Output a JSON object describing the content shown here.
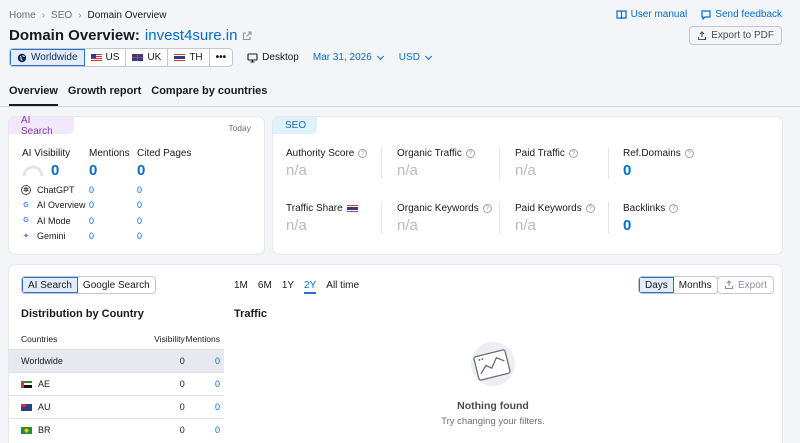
{
  "breadcrumb": [
    "Home",
    "SEO",
    "Domain Overview"
  ],
  "header": {
    "title": "Domain Overview:",
    "domain": "invest4sure.in",
    "user_manual": "User manual",
    "send_feedback": "Send feedback",
    "export_pdf": "Export to PDF"
  },
  "filters": {
    "regions": [
      {
        "label": "Worldwide",
        "icon": "globe-icon",
        "active": true
      },
      {
        "label": "US",
        "icon": "us-flag-icon"
      },
      {
        "label": "UK",
        "icon": "uk-flag-icon"
      },
      {
        "label": "TH",
        "icon": "th-flag-icon"
      },
      {
        "label": "•••",
        "icon": "more-icon"
      }
    ],
    "device": "Desktop",
    "date": "Mar 31, 2026",
    "currency": "USD"
  },
  "tabs": [
    "Overview",
    "Growth report",
    "Compare by countries"
  ],
  "ai_card": {
    "tag": "AI Search",
    "period": "Today",
    "visibility_label": "AI Visibility",
    "visibility_value": "0",
    "mentions_label": "Mentions",
    "mentions_value": "0",
    "cited_label": "Cited Pages",
    "cited_value": "0",
    "rows": [
      {
        "name": "ChatGPT",
        "mentions": "0",
        "cited": "0"
      },
      {
        "name": "AI Overview",
        "mentions": "0",
        "cited": "0"
      },
      {
        "name": "AI Mode",
        "mentions": "0",
        "cited": "0"
      },
      {
        "name": "Gemini",
        "mentions": "0",
        "cited": "0"
      }
    ]
  },
  "seo_card": {
    "tag": "SEO",
    "metrics": [
      {
        "label": "Authority Score",
        "value": "n/a"
      },
      {
        "label": "Organic Traffic",
        "value": "n/a"
      },
      {
        "label": "Paid Traffic",
        "value": "n/a"
      },
      {
        "label": "Ref.Domains",
        "value": "0"
      },
      {
        "label": "Traffic Share",
        "value": "n/a"
      },
      {
        "label": "Organic Keywords",
        "value": "n/a"
      },
      {
        "label": "Paid Keywords",
        "value": "n/a"
      },
      {
        "label": "Backlinks",
        "value": "0"
      }
    ]
  },
  "bottom": {
    "search_toggle": [
      "AI Search",
      "Google Search"
    ],
    "ranges": [
      "1M",
      "6M",
      "1Y",
      "2Y",
      "All time"
    ],
    "active_range": "2Y",
    "granularity": [
      "Days",
      "Months"
    ],
    "export": "Export",
    "distribution_title": "Distribution by Country",
    "columns": [
      "Countries",
      "Visibility",
      "Mentions"
    ],
    "rows": [
      {
        "country": "Worldwide",
        "visibility": "0",
        "mentions": "0"
      },
      {
        "country": "AE",
        "visibility": "0",
        "mentions": "0"
      },
      {
        "country": "AU",
        "visibility": "0",
        "mentions": "0"
      },
      {
        "country": "BR",
        "visibility": "0",
        "mentions": "0"
      }
    ],
    "traffic_title": "Traffic",
    "empty_title": "Nothing found",
    "empty_subtitle": "Try changing your filters."
  }
}
